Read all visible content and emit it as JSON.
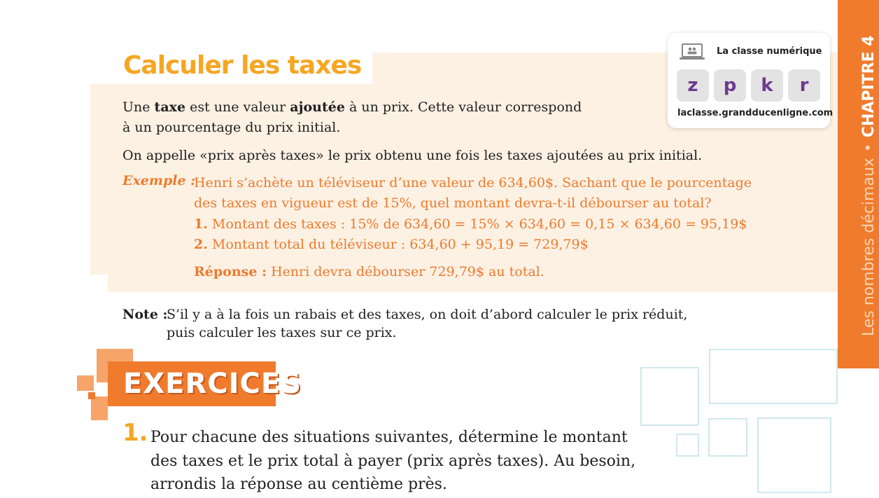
{
  "section": {
    "title": "Calculer les taxes"
  },
  "definition": {
    "line1_a": "Une ",
    "line1_b": "taxe",
    "line1_c": " est une valeur ",
    "line1_d": "ajoutée",
    "line1_e": " à un prix. Cette valeur correspond",
    "line2": "à un pourcentage du prix initial.",
    "line3": "On appelle «prix après taxes» le prix obtenu une fois les taxes ajoutées au prix initial."
  },
  "example": {
    "label": "Exemple :",
    "line1": "Henri s’achète un téléviseur d’une valeur de 634,60$. Sachant que le pourcentage",
    "line2": "des taxes en vigueur est de 15%, quel montant devra-t-il débourser au total?",
    "step1_num": "1.",
    "step1_text": " Montant des taxes : 15% de 634,60 = 15% × 634,60 = 0,15 × 634,60 = 95,19$",
    "step2_num": "2.",
    "step2_text": " Montant total du téléviseur : 634,60 + 95,19 = 729,79$",
    "answer_label": "Réponse :",
    "answer_text": " Henri devra débourser 729,79$ au total."
  },
  "note": {
    "label": "Note :",
    "line1": "S’il y a à la fois un rabais et des taxes, on doit d’abord calculer le prix réduit,",
    "line2": "puis calculer les taxes sur ce prix."
  },
  "numeric_class": {
    "title": "La classe numérique",
    "icon": "laptop-icon",
    "keys": [
      "z",
      "p",
      "k",
      "r"
    ],
    "url": "laclasse.grandducenligne.com"
  },
  "side_tab": {
    "chapter": "CHAPITRE 4",
    "separator": "•",
    "topic": "Les nombres décimaux"
  },
  "exercises": {
    "banner": "EXERCICES",
    "question_number": "1.",
    "question_line1": "Pour chacune des situations suivantes, détermine le montant",
    "question_line2": "des taxes et le prix total à payer (prix après taxes). Au besoin,",
    "question_line3": "arrondis la réponse au centième près."
  },
  "colors": {
    "accent_orange": "#f07b2c",
    "title_yellow": "#f6a623",
    "panel_bg": "#fdf1e4",
    "key_purple": "#6c3b8e"
  }
}
